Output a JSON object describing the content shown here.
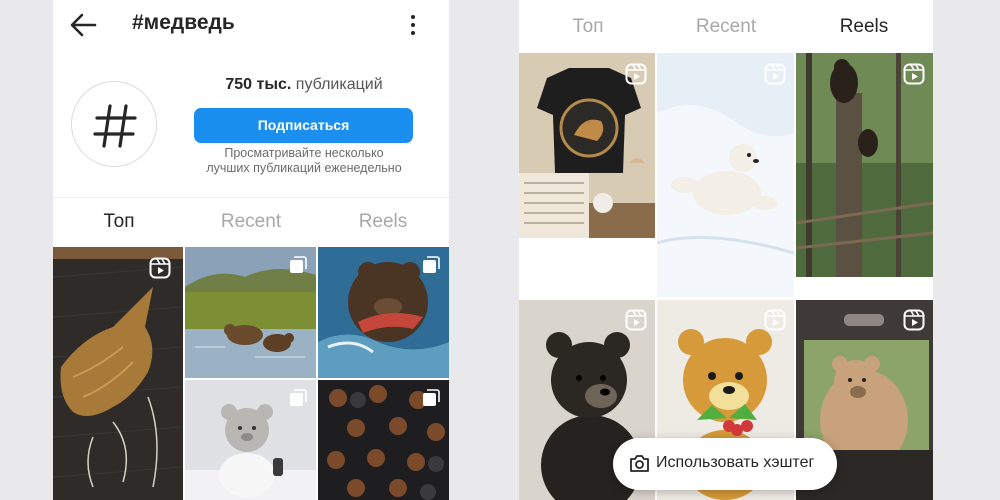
{
  "header": {
    "title": "#медведь",
    "back_icon": "arrow-left-icon",
    "more_icon": "more-vertical-icon"
  },
  "profile": {
    "avatar_icon": "hashtag-icon",
    "posts_count": "750 тыс.",
    "posts_label": "публикаций",
    "follow_label": "Подписаться",
    "hint_line1": "Просматривайте несколько",
    "hint_line2": "лучших публикаций еженедельно"
  },
  "tabs_left": [
    {
      "label": "Топ",
      "active": true
    },
    {
      "label": "Recent",
      "active": false
    },
    {
      "label": "Reels",
      "active": false
    }
  ],
  "tabs_right": [
    {
      "label": "Топ",
      "active": false
    },
    {
      "label": "Recent",
      "active": false
    },
    {
      "label": "Reels",
      "active": true
    }
  ],
  "left_grid": [
    {
      "subject": "embroidered-bear",
      "badge": "reels-icon"
    },
    {
      "subject": "bears-in-river",
      "badge": "carousel-icon"
    },
    {
      "subject": "bear-catching-salmon",
      "badge": "carousel-icon"
    },
    {
      "subject": "white-teddy-bear",
      "badge": "carousel-icon"
    },
    {
      "subject": "bear-chocolates",
      "badge": "carousel-icon"
    }
  ],
  "right_grid": [
    {
      "subject": "bear-embroidered-shirt",
      "badge": "reels-icon"
    },
    {
      "subject": "polar-bear-cub-snow",
      "badge": "reels-icon"
    },
    {
      "subject": "cubs-climbing-tree",
      "badge": "reels-icon"
    },
    {
      "subject": "black-bear-cub",
      "badge": "reels-icon"
    },
    {
      "subject": "felt-orange-bear",
      "badge": "reels-icon"
    },
    {
      "subject": "bear-at-car-window",
      "badge": "reels-icon"
    }
  ],
  "cta": {
    "icon": "camera-icon",
    "label": "Использовать хэштег"
  },
  "colors": {
    "accent": "#1a8ff0",
    "text": "#262626",
    "muted": "#a8a8a8",
    "background": "#e9e9eb"
  }
}
